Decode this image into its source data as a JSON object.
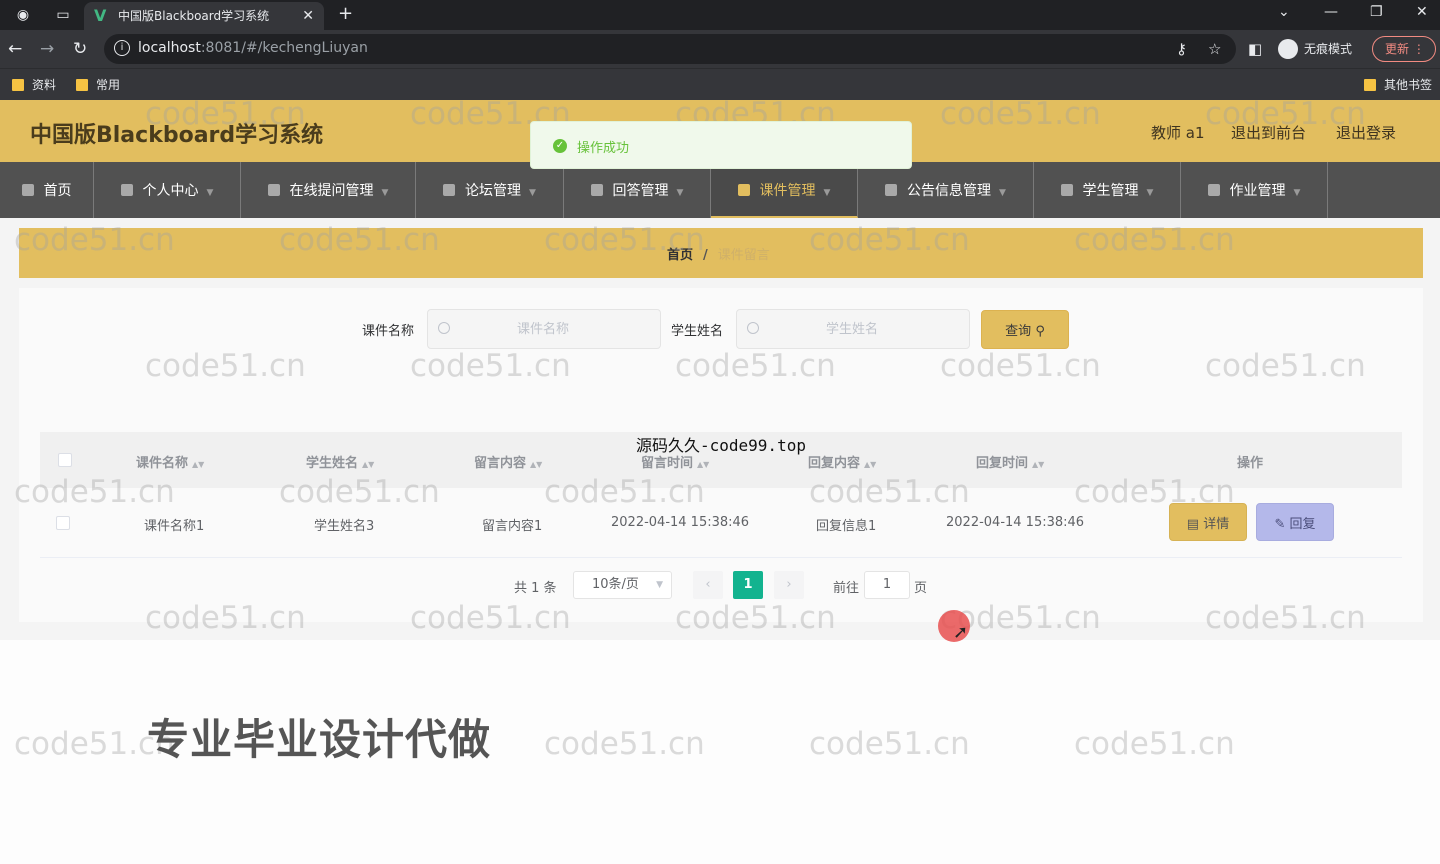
{
  "browser": {
    "tab_title": "中国版Blackboard学习系统",
    "tab_favicon": "V",
    "url_host": "localhost",
    "url_rest": ":8081/#/kechengLiuyan",
    "profile_label": "无痕模式",
    "update_label": "更新",
    "bookmarks": [
      "资料",
      "常用"
    ],
    "other_bookmarks": "其他书签"
  },
  "header": {
    "title": "中国版Blackboard学习系统",
    "user": "教师 a1",
    "back_to_front": "退出到前台",
    "logout": "退出登录"
  },
  "toast": {
    "message": "操作成功"
  },
  "menu": {
    "items": [
      {
        "label": "首页"
      },
      {
        "label": "个人中心"
      },
      {
        "label": "在线提问管理"
      },
      {
        "label": "论坛管理"
      },
      {
        "label": "回答管理"
      },
      {
        "label": "课件管理"
      },
      {
        "label": "公告信息管理"
      },
      {
        "label": "学生管理"
      },
      {
        "label": "作业管理"
      }
    ]
  },
  "breadcrumb": {
    "home": "首页",
    "separator": "/",
    "current": "课件留言"
  },
  "search": {
    "course_label": "课件名称",
    "course_placeholder": "课件名称",
    "student_label": "学生姓名",
    "student_placeholder": "学生姓名",
    "query_label": "查询"
  },
  "table": {
    "columns": [
      "课件名称",
      "学生姓名",
      "留言内容",
      "留言时间",
      "回复内容",
      "回复时间",
      "操作"
    ],
    "rows": [
      {
        "course": "课件名称1",
        "student": "学生姓名3",
        "content": "留言内容1",
        "time": "2022-04-14 15:38:46",
        "reply": "回复信息1",
        "reply_time": "2022-04-14 15:38:46",
        "detail_label": "详情",
        "reply_label": "回复"
      }
    ]
  },
  "pagination": {
    "total": "共 1 条",
    "page_size": "10条/页",
    "current": "1",
    "goto_prefix": "前往",
    "goto_value": "1",
    "goto_suffix": "页"
  },
  "overlays": {
    "watermark": "code51.cn",
    "source_text": "源码久久-code99.top",
    "ad_text": "专业毕业设计代做"
  },
  "colors": {
    "accent": "#e2be5f",
    "menu_bg": "#515151",
    "page_active": "#13b38f",
    "success": "#67c23a"
  }
}
